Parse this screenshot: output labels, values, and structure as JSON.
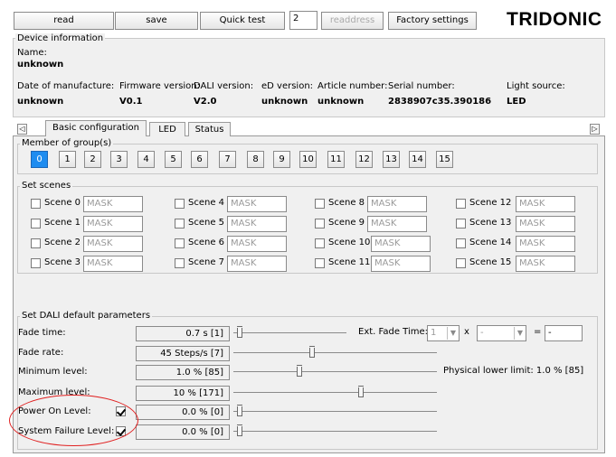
{
  "toolbar": {
    "read": "read",
    "save": "save",
    "quick_test": "Quick test",
    "address_value": "2",
    "readdress": "readdress",
    "factory_settings": "Factory settings",
    "logo": "TRIDONIC"
  },
  "device_info": {
    "group_title": "Device information",
    "name_label": "Name:",
    "name_value": "unknown",
    "fields": [
      {
        "label": "Date of manufacture:",
        "value": "unknown"
      },
      {
        "label": "Firmware version:",
        "value": "V0.1"
      },
      {
        "label": "DALI version:",
        "value": "V2.0"
      },
      {
        "label": "eD version:",
        "value": "unknown"
      },
      {
        "label": "Article number:",
        "value": "unknown"
      },
      {
        "label": "Serial number:",
        "value": "2838907c35.390186"
      },
      {
        "label": "Light source:",
        "value": "LED"
      }
    ]
  },
  "tabs": [
    {
      "label": "Basic configuration",
      "active": true
    },
    {
      "label": "LED",
      "active": false
    },
    {
      "label": "Status",
      "active": false
    }
  ],
  "groups": {
    "title": "Member of group(s)",
    "buttons": [
      "0",
      "1",
      "2",
      "3",
      "4",
      "5",
      "6",
      "7",
      "8",
      "9",
      "10",
      "11",
      "12",
      "13",
      "14",
      "15"
    ],
    "selected": "0"
  },
  "scenes": {
    "title": "Set scenes",
    "items": [
      {
        "label": "Scene 0",
        "value": "MASK"
      },
      {
        "label": "Scene 1",
        "value": "MASK"
      },
      {
        "label": "Scene 2",
        "value": "MASK"
      },
      {
        "label": "Scene 3",
        "value": "MASK"
      },
      {
        "label": "Scene 4",
        "value": "MASK"
      },
      {
        "label": "Scene 5",
        "value": "MASK"
      },
      {
        "label": "Scene 6",
        "value": "MASK"
      },
      {
        "label": "Scene 7",
        "value": "MASK"
      },
      {
        "label": "Scene 8",
        "value": "MASK"
      },
      {
        "label": "Scene 9",
        "value": "MASK"
      },
      {
        "label": "Scene 10",
        "value": "MASK"
      },
      {
        "label": "Scene 11",
        "value": "MASK"
      },
      {
        "label": "Scene 12",
        "value": "MASK"
      },
      {
        "label": "Scene 13",
        "value": "MASK"
      },
      {
        "label": "Scene 14",
        "value": "MASK"
      },
      {
        "label": "Scene 15",
        "value": "MASK"
      }
    ]
  },
  "defaults": {
    "title": "Set DALI default parameters",
    "rows": [
      {
        "label": "Fade time:",
        "value": "0.7 s [1]",
        "level": 0.0
      },
      {
        "label": "Fade rate:",
        "value": "45 Steps/s [7]",
        "level": 0.4
      },
      {
        "label": "Minimum level:",
        "value": "1.0 % [85]",
        "level": 0.33
      },
      {
        "label": "Maximum level:",
        "value": "10 % [171]",
        "level": 0.67
      },
      {
        "label": "Power On Level:",
        "value": "0.0 % [0]",
        "level": 0.0,
        "checked": true
      },
      {
        "label": "System Failure Level:",
        "value": "0.0 % [0]",
        "level": 0.0,
        "checked": true
      }
    ],
    "ext_fade_label": "Ext. Fade Time:",
    "ext_fade_value1": "1",
    "ext_fade_x": "x",
    "ext_fade_value2": "-",
    "ext_fade_eq": "=",
    "ext_fade_result": "-",
    "physical_lower_limit": "Physical lower limit: 1.0 % [85]"
  },
  "colors": {
    "selected_group": "#1e8cf0",
    "annotation": "#e02020",
    "panel_bg": "#f0f0f0"
  }
}
